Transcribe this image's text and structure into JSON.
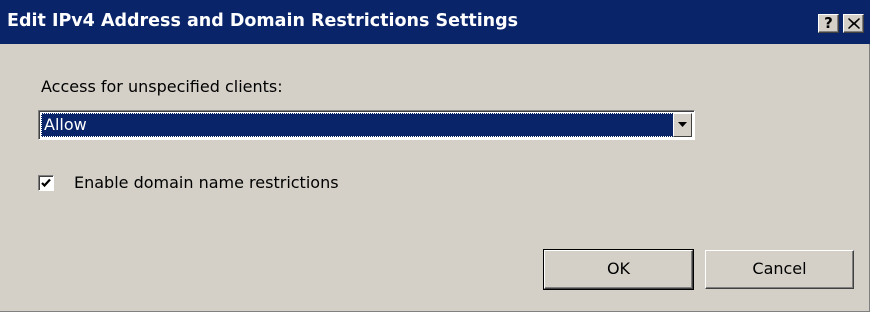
{
  "window": {
    "title": "Edit IPv4 Address and Domain Restrictions Settings",
    "help_label": "?",
    "close_icon": "close-icon"
  },
  "access": {
    "label": "Access for unspecified clients:",
    "selected_value": "Allow",
    "dropdown_icon": "chevron-down-icon"
  },
  "domain_restrictions": {
    "label": "Enable domain name restrictions",
    "checked": true
  },
  "buttons": {
    "ok_label": "OK",
    "cancel_label": "Cancel"
  },
  "colors": {
    "titlebar": "#0a246a",
    "dialog_background": "#d4d0c8",
    "selection": "#0a246a"
  }
}
